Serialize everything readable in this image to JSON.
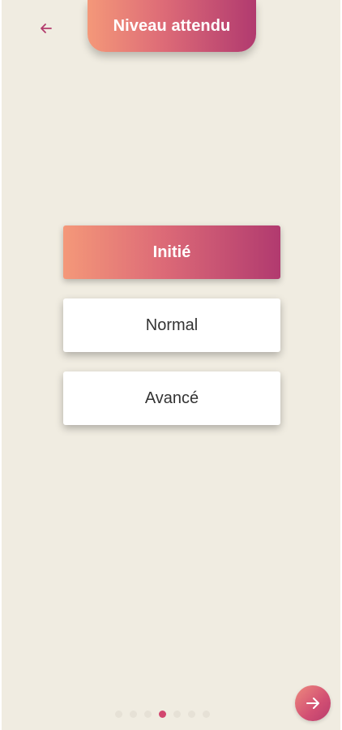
{
  "header": {
    "title": "Niveau attendu",
    "back_icon": "arrow-left-icon"
  },
  "options": [
    {
      "label": "Initié",
      "selected": true
    },
    {
      "label": "Normal",
      "selected": false
    },
    {
      "label": "Avancé",
      "selected": false
    }
  ],
  "pagination": {
    "total": 7,
    "active_index": 3
  },
  "next_button": {
    "icon": "arrow-right-icon"
  },
  "colors": {
    "background": "#f0ece1",
    "gradient_start": "#f49879",
    "gradient_end": "#b13a6f",
    "accent": "#d2476f",
    "option_text": "#333333"
  }
}
